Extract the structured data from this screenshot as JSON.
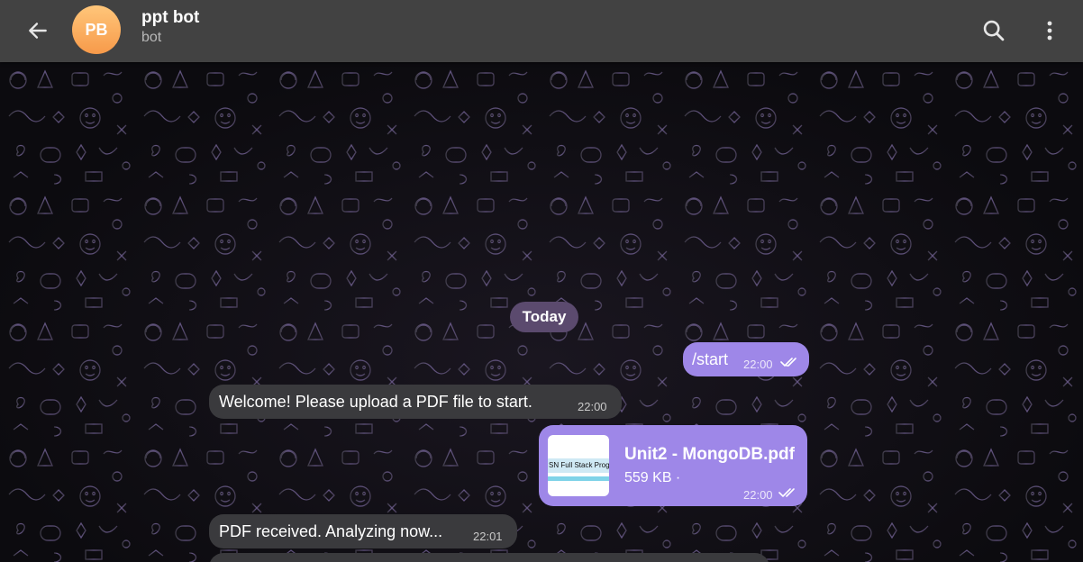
{
  "header": {
    "back_icon": "arrow-left-icon",
    "avatar_initials": "PB",
    "avatar_color": "#f9a85a",
    "title": "ppt bot",
    "subtitle": "bot",
    "search_icon": "search-icon",
    "menu_icon": "more-vertical-icon"
  },
  "chat": {
    "date_label": "Today",
    "messages": [
      {
        "direction": "out",
        "text": "/start",
        "time": "22:00",
        "status": "read"
      },
      {
        "direction": "in",
        "text": "Welcome! Please upload a PDF file to start.",
        "time": "22:00"
      },
      {
        "direction": "out",
        "type": "file",
        "file_name": "Unit2 - MongoDB.pdf",
        "file_size": "559 KB ·",
        "thumb_caption": "SN Full Stack Program",
        "time": "22:00",
        "status": "read"
      },
      {
        "direction": "in",
        "text": "PDF received. Analyzing now...",
        "time": "22:01"
      }
    ]
  },
  "colors": {
    "header_bg": "#424242",
    "outgoing_bubble": "#9e87e8",
    "incoming_bubble": "#3a3a3d",
    "date_pill": "#5b4a6e"
  }
}
